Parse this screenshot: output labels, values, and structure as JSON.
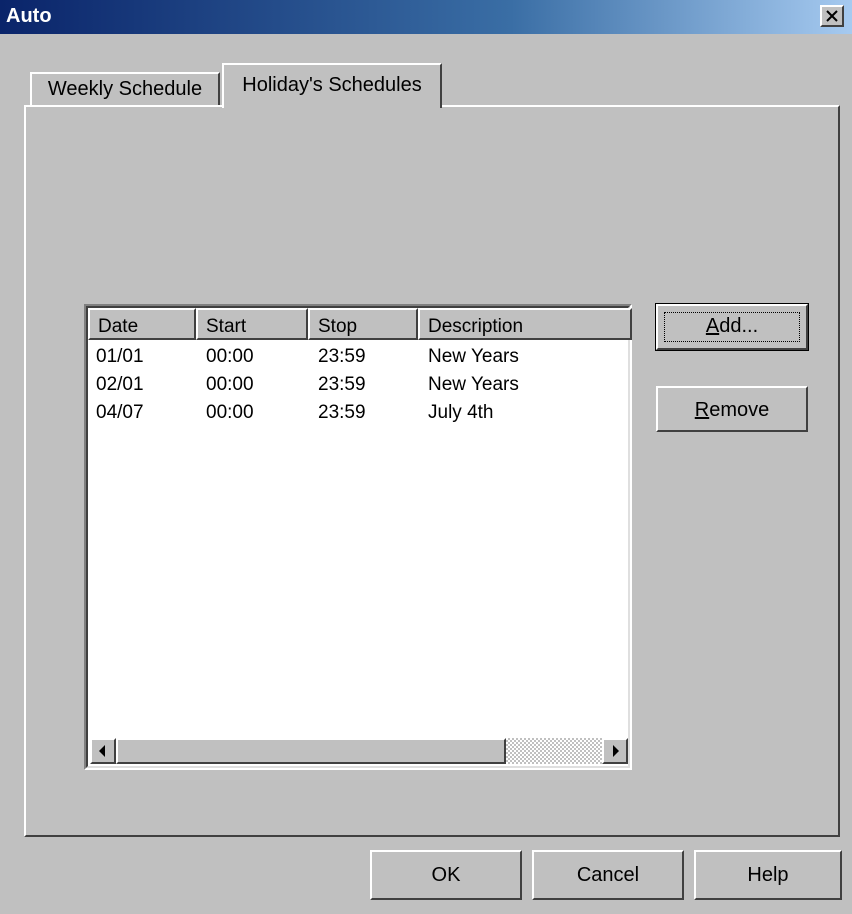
{
  "window": {
    "title": "Auto"
  },
  "tabs": [
    {
      "label": "Weekly Schedule",
      "active": false
    },
    {
      "label": "Holiday's Schedules",
      "active": true
    }
  ],
  "list": {
    "columns": [
      "Date",
      "Start",
      "Stop",
      "Description"
    ],
    "rows": [
      {
        "date": "01/01",
        "start": "00:00",
        "stop": "23:59",
        "description": "New Years"
      },
      {
        "date": "02/01",
        "start": "00:00",
        "stop": "23:59",
        "description": "New Years"
      },
      {
        "date": "04/07",
        "start": "00:00",
        "stop": "23:59",
        "description": "July 4th"
      }
    ]
  },
  "buttons": {
    "add_mnemonic": "A",
    "add_rest": "dd...",
    "remove_mnemonic": "R",
    "remove_rest": "emove",
    "ok": "OK",
    "cancel": "Cancel",
    "help": "Help"
  },
  "icons": {
    "close": "close-icon",
    "scroll_left": "arrow-left-icon",
    "scroll_right": "arrow-right-icon"
  }
}
